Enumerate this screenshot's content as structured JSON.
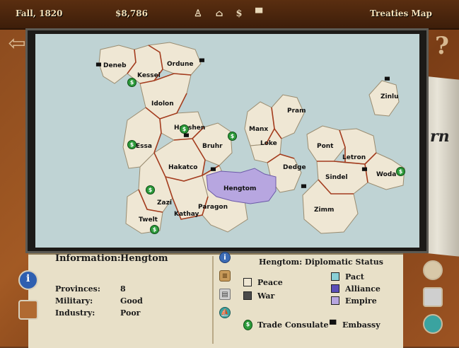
{
  "topbar": {
    "season": "Fall, 1820",
    "money": "$8,786",
    "screen_title": "Treaties Map",
    "icons": [
      "chess-pawn-icon",
      "factory-icon",
      "trade-consulate-icon",
      "embassy-hat-icon"
    ]
  },
  "map": {
    "provinces": [
      {
        "name": "Deneb"
      },
      {
        "name": "Kessel"
      },
      {
        "name": "Ordune"
      },
      {
        "name": "Idolon"
      },
      {
        "name": "Zinlu"
      },
      {
        "name": "Pram"
      },
      {
        "name": "Hapshen"
      },
      {
        "name": "Manx"
      },
      {
        "name": "Bruhr"
      },
      {
        "name": "Essa"
      },
      {
        "name": "Loke"
      },
      {
        "name": "Pont"
      },
      {
        "name": "Letron"
      },
      {
        "name": "Hakatco"
      },
      {
        "name": "Dedge"
      },
      {
        "name": "Sindel"
      },
      {
        "name": "Woda"
      },
      {
        "name": "Hengtom"
      },
      {
        "name": "Zazi"
      },
      {
        "name": "Kathay"
      },
      {
        "name": "Zimm"
      },
      {
        "name": "Paragon"
      },
      {
        "name": "Twelt"
      }
    ]
  },
  "info": {
    "header_label": "Information:",
    "header_value": "Hengtom",
    "rows": [
      {
        "label": "Provinces:",
        "value": "8"
      },
      {
        "label": "Military:",
        "value": "Good"
      },
      {
        "label": "Industry:",
        "value": "Poor"
      }
    ]
  },
  "legend": {
    "title": "Hengtom: Diplomatic Status",
    "items": [
      {
        "label": "Peace",
        "color": "#efe7d4"
      },
      {
        "label": "War",
        "color": "#4a4a4a"
      },
      {
        "label": "Pact",
        "color": "#8ad0d6"
      },
      {
        "label": "Alliance",
        "color": "#5b4fb8"
      },
      {
        "label": "Empire",
        "color": "#b7a6e0"
      }
    ],
    "trade_consulate": "Trade Consulate",
    "embassy": "Embassy"
  },
  "colors": {
    "sea": "#bfd3d4",
    "land": "#efe7d4",
    "border": "#a43c1e",
    "selected": "#b7a6e0"
  }
}
